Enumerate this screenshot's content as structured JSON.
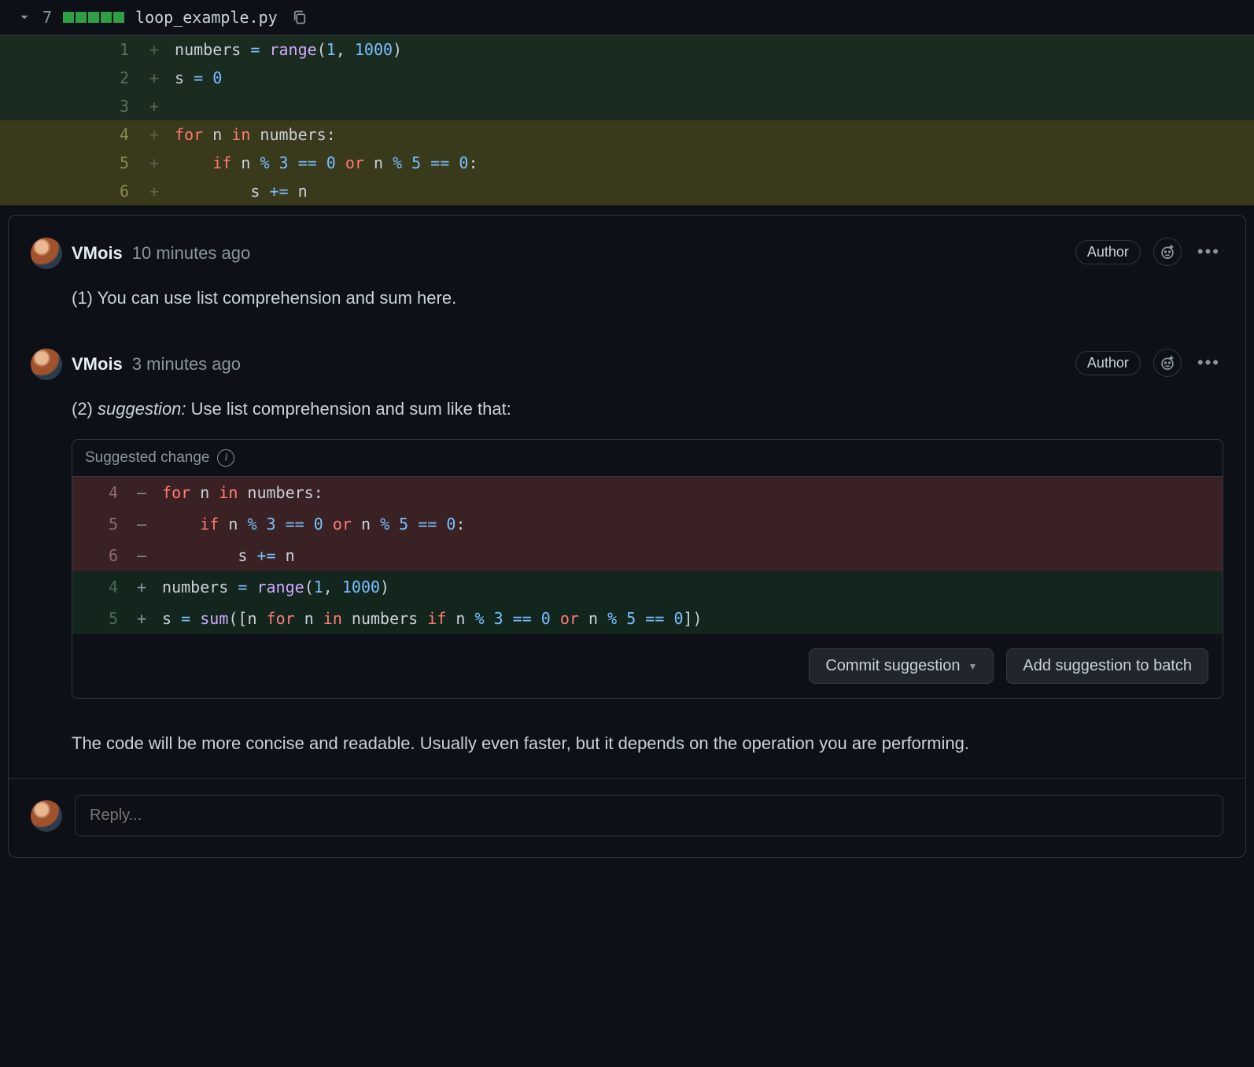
{
  "file": {
    "hits": "7",
    "name": "loop_example.py"
  },
  "diff": [
    {
      "n": "1",
      "hl": false,
      "tokens": [
        [
          "id",
          "numbers "
        ],
        [
          "op",
          "="
        ],
        [
          "id",
          " "
        ],
        [
          "fn",
          "range"
        ],
        [
          "id",
          "("
        ],
        [
          "num",
          "1"
        ],
        [
          "id",
          ", "
        ],
        [
          "num",
          "1000"
        ],
        [
          "id",
          ")"
        ]
      ]
    },
    {
      "n": "2",
      "hl": false,
      "tokens": [
        [
          "id",
          "s "
        ],
        [
          "op",
          "="
        ],
        [
          "id",
          " "
        ],
        [
          "num",
          "0"
        ]
      ]
    },
    {
      "n": "3",
      "hl": false,
      "tokens": []
    },
    {
      "n": "4",
      "hl": true,
      "tokens": [
        [
          "kw",
          "for"
        ],
        [
          "id",
          " n "
        ],
        [
          "kw",
          "in"
        ],
        [
          "id",
          " numbers:"
        ]
      ]
    },
    {
      "n": "5",
      "hl": true,
      "tokens": [
        [
          "id",
          "    "
        ],
        [
          "kw",
          "if"
        ],
        [
          "id",
          " n "
        ],
        [
          "op",
          "%"
        ],
        [
          "id",
          " "
        ],
        [
          "num",
          "3"
        ],
        [
          "id",
          " "
        ],
        [
          "op",
          "=="
        ],
        [
          "id",
          " "
        ],
        [
          "num",
          "0"
        ],
        [
          "id",
          " "
        ],
        [
          "kw",
          "or"
        ],
        [
          "id",
          " n "
        ],
        [
          "op",
          "%"
        ],
        [
          "id",
          " "
        ],
        [
          "num",
          "5"
        ],
        [
          "id",
          " "
        ],
        [
          "op",
          "=="
        ],
        [
          "id",
          " "
        ],
        [
          "num",
          "0"
        ],
        [
          "id",
          ":"
        ]
      ]
    },
    {
      "n": "6",
      "hl": true,
      "tokens": [
        [
          "id",
          "        s "
        ],
        [
          "op",
          "+="
        ],
        [
          "id",
          " n"
        ]
      ]
    }
  ],
  "comments": [
    {
      "user": "VMois",
      "time": "10 minutes ago",
      "badge": "Author",
      "body_prefix": "(1) ",
      "body_em": "",
      "body_rest": "You can use list comprehension and sum here."
    },
    {
      "user": "VMois",
      "time": "3 minutes ago",
      "badge": "Author",
      "body_prefix": "(2) ",
      "body_em": "suggestion:",
      "body_rest": " Use list comprehension and sum like that:"
    }
  ],
  "suggestion": {
    "label": "Suggested change",
    "del": [
      {
        "n": "4",
        "tokens": [
          [
            "kw",
            "for"
          ],
          [
            "id",
            " n "
          ],
          [
            "kw",
            "in"
          ],
          [
            "id",
            " numbers:"
          ]
        ]
      },
      {
        "n": "5",
        "tokens": [
          [
            "id",
            "    "
          ],
          [
            "kw",
            "if"
          ],
          [
            "id",
            " n "
          ],
          [
            "op",
            "%"
          ],
          [
            "id",
            " "
          ],
          [
            "num",
            "3"
          ],
          [
            "id",
            " "
          ],
          [
            "op",
            "=="
          ],
          [
            "id",
            " "
          ],
          [
            "num",
            "0"
          ],
          [
            "id",
            " "
          ],
          [
            "kw",
            "or"
          ],
          [
            "id",
            " n "
          ],
          [
            "op",
            "%"
          ],
          [
            "id",
            " "
          ],
          [
            "num",
            "5"
          ],
          [
            "id",
            " "
          ],
          [
            "op",
            "=="
          ],
          [
            "id",
            " "
          ],
          [
            "num",
            "0"
          ],
          [
            "id",
            ":"
          ]
        ]
      },
      {
        "n": "6",
        "tokens": [
          [
            "id",
            "        s "
          ],
          [
            "op",
            "+="
          ],
          [
            "id",
            " n"
          ]
        ]
      }
    ],
    "add": [
      {
        "n": "4",
        "tokens": [
          [
            "id",
            "numbers "
          ],
          [
            "op",
            "="
          ],
          [
            "id",
            " "
          ],
          [
            "fn",
            "range"
          ],
          [
            "id",
            "("
          ],
          [
            "num",
            "1"
          ],
          [
            "id",
            ", "
          ],
          [
            "num",
            "1000"
          ],
          [
            "id",
            ")"
          ]
        ]
      },
      {
        "n": "5",
        "tokens": [
          [
            "id",
            "s "
          ],
          [
            "op",
            "="
          ],
          [
            "id",
            " "
          ],
          [
            "fn",
            "sum"
          ],
          [
            "id",
            "([n "
          ],
          [
            "kw",
            "for"
          ],
          [
            "id",
            " n "
          ],
          [
            "kw",
            "in"
          ],
          [
            "id",
            " numbers "
          ],
          [
            "kw",
            "if"
          ],
          [
            "id",
            " n "
          ],
          [
            "op",
            "%"
          ],
          [
            "id",
            " "
          ],
          [
            "num",
            "3"
          ],
          [
            "id",
            " "
          ],
          [
            "op",
            "=="
          ],
          [
            "id",
            " "
          ],
          [
            "num",
            "0"
          ],
          [
            "id",
            " "
          ],
          [
            "kw",
            "or"
          ],
          [
            "id",
            " n "
          ],
          [
            "op",
            "%"
          ],
          [
            "id",
            " "
          ],
          [
            "num",
            "5"
          ],
          [
            "id",
            " "
          ],
          [
            "op",
            "=="
          ],
          [
            "id",
            " "
          ],
          [
            "num",
            "0"
          ],
          [
            "id",
            "])"
          ]
        ]
      }
    ],
    "commit_label": "Commit suggestion",
    "batch_label": "Add suggestion to batch"
  },
  "followup": "The code will be more concise and readable. Usually even faster, but it depends on the operation you are performing.",
  "reply_placeholder": "Reply..."
}
